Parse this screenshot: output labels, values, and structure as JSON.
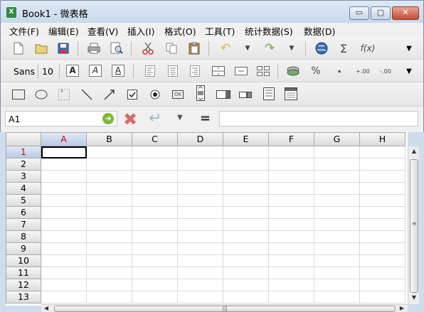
{
  "window": {
    "title": "Book1 - 微表格",
    "app_icon": "X",
    "controls": {
      "minimize": "▭",
      "maximize": "▢",
      "close": "✕"
    }
  },
  "menu": [
    "文件(F)",
    "编辑(E)",
    "查看(V)",
    "插入(I)",
    "格式(O)",
    "工具(T)",
    "统计数据(S)",
    "数据(D)"
  ],
  "toolbar1": {
    "icons": [
      "new-file-icon",
      "open-folder-icon",
      "save-icon",
      "print-icon",
      "print-preview-icon",
      "cut-icon",
      "copy-icon",
      "paste-icon",
      "undo-icon",
      "undo-dropdown-icon",
      "redo-icon",
      "redo-dropdown-icon",
      "globe-icon",
      "sum-icon",
      "function-icon",
      "overflow-dropdown-icon"
    ],
    "glyphs": {
      "sum": "Σ",
      "function": "f(x)"
    }
  },
  "toolbar2": {
    "font_name": "Sans",
    "font_size": "10",
    "bold": "A",
    "italic": "A",
    "underline": "A",
    "percent": "%",
    "thousands": "·",
    "increase_decimal": "+.00",
    "decrease_decimal": "-.00"
  },
  "toolbar3": {
    "icons": [
      "rectangle-icon",
      "ellipse-icon",
      "label-icon",
      "line-icon",
      "arrow-icon",
      "checkbox-icon",
      "radio-icon",
      "button-icon",
      "scrollbar-icon",
      "list-icon",
      "combo-icon",
      "frame-icon",
      "graph-icon"
    ],
    "button_text": "OK"
  },
  "formula": {
    "cell_ref": "A1",
    "value": "",
    "equals": "="
  },
  "grid": {
    "columns": [
      "A",
      "B",
      "C",
      "D",
      "E",
      "F",
      "G",
      "H"
    ],
    "rows": [
      "1",
      "2",
      "3",
      "4",
      "5",
      "6",
      "7",
      "8",
      "9",
      "10",
      "11",
      "12",
      "13"
    ],
    "selected_column": "A",
    "selected_row": "1",
    "active_cell": "A1"
  },
  "scrollbars": {
    "up": "▲",
    "down": "▼",
    "left": "◀",
    "right": "▶",
    "grip_h": "|||",
    "grip_v": "≡"
  }
}
